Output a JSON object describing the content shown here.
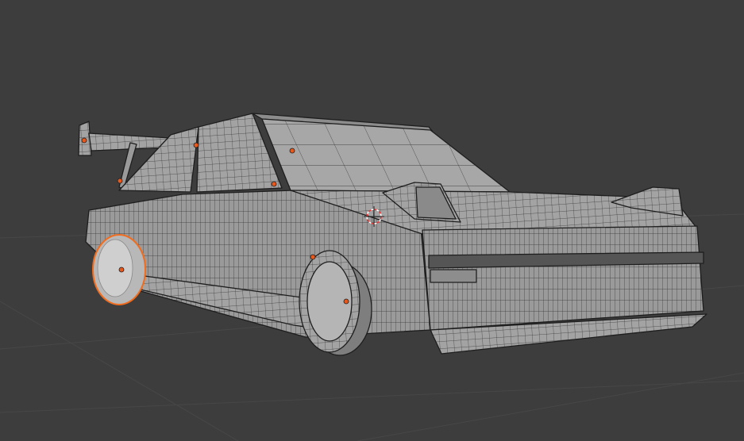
{
  "viewport": {
    "mode": "3d-viewport-edit-mode",
    "background_color": "#3d3d3d",
    "grid_color": "#474747",
    "mesh_color": "#a3a3a3",
    "mesh_dark_color": "#6e6e6e",
    "wire_color": "#2a2a2a",
    "selection_color": "#f26c1e",
    "origin_color": "#e8581b"
  },
  "scene": {
    "object": "car-mesh",
    "icons": [
      "3d-cursor-icon",
      "object-origin-icon"
    ]
  }
}
